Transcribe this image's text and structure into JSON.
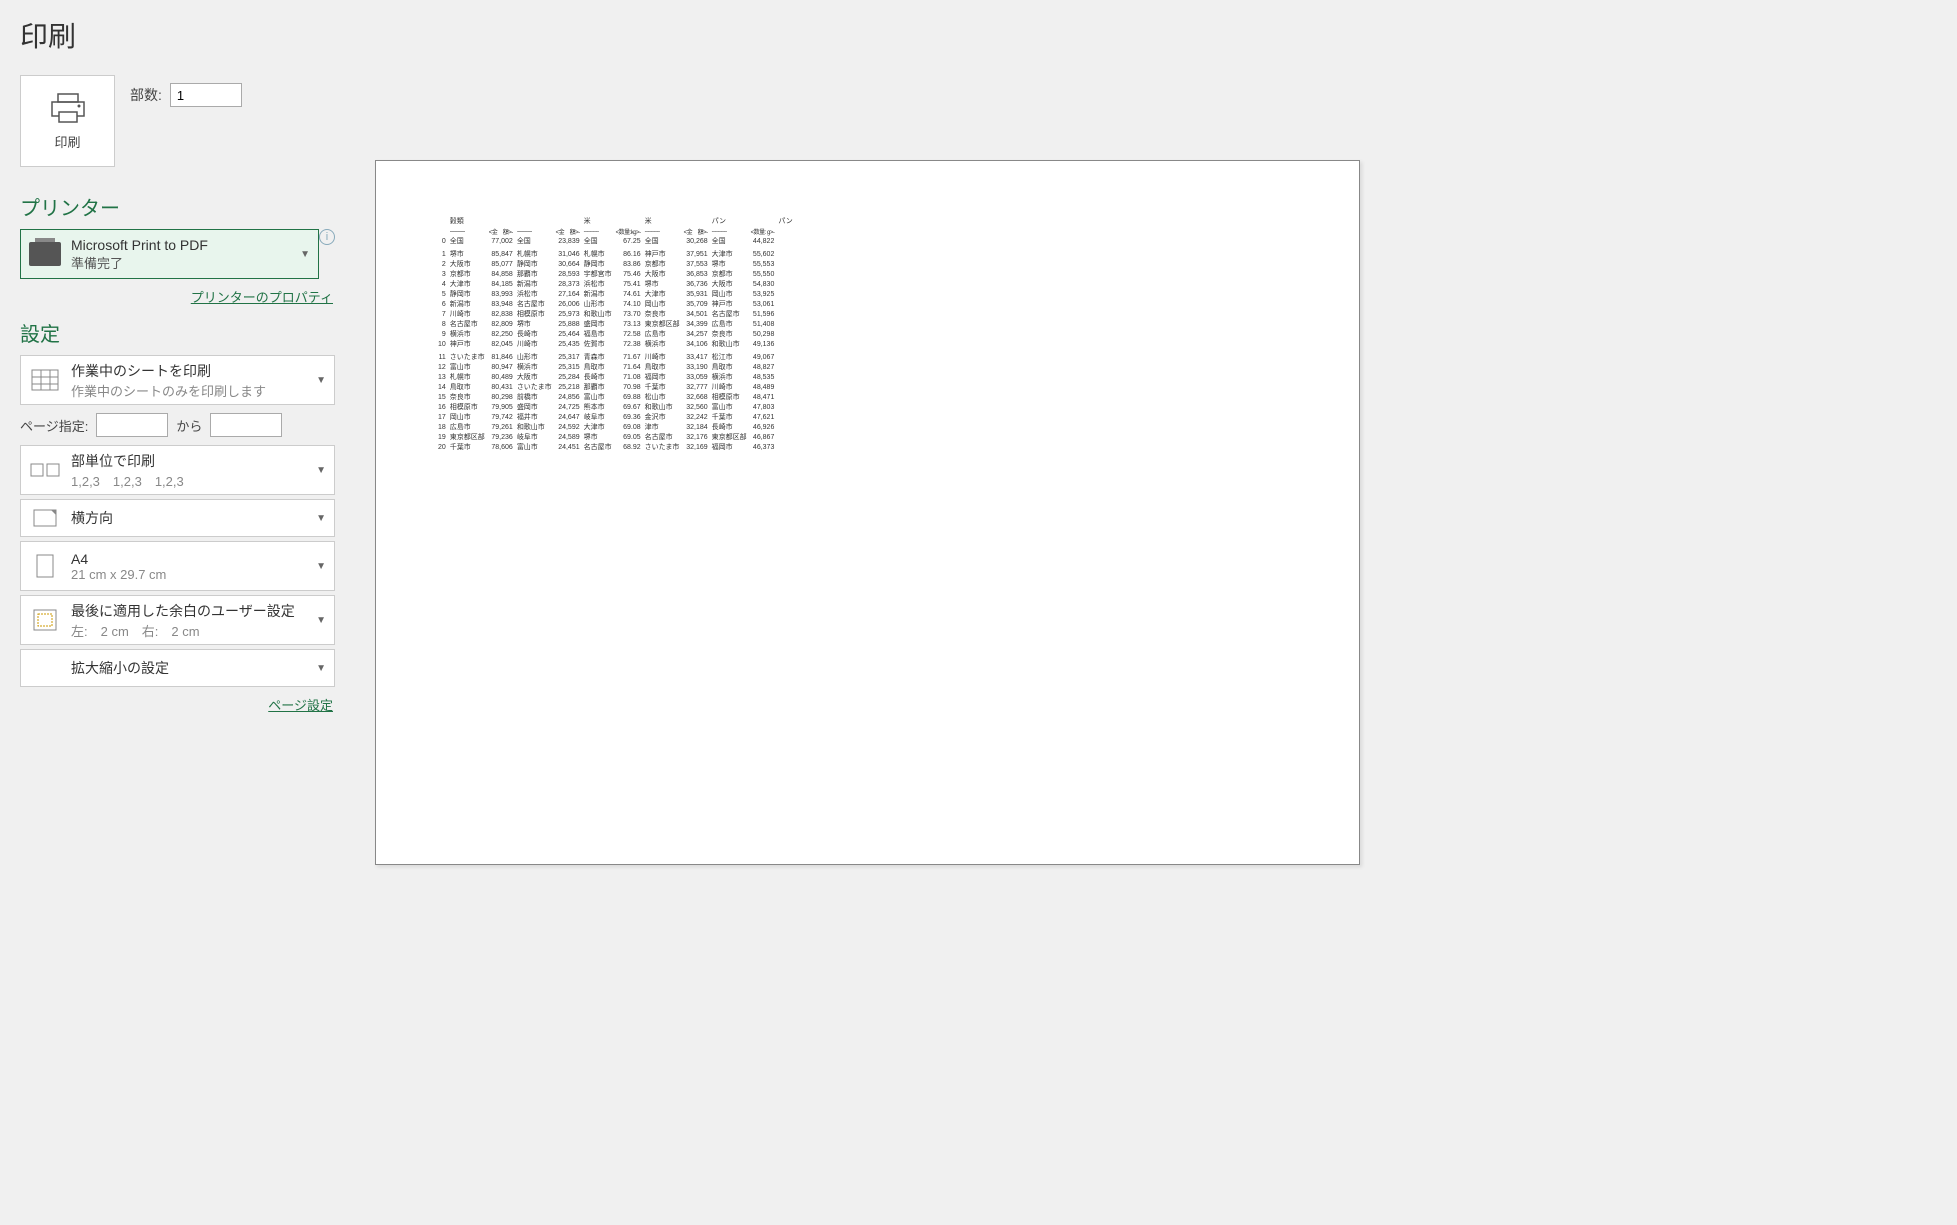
{
  "title": "印刷",
  "print_button": "印刷",
  "copies": {
    "label": "部数:",
    "value": "1"
  },
  "printer_section": {
    "heading": "プリンター",
    "selected": {
      "name": "Microsoft Print to PDF",
      "status": "準備完了"
    },
    "properties_link": "プリンターのプロパティ"
  },
  "settings_section": {
    "heading": "設定",
    "print_what": {
      "main": "作業中のシートを印刷",
      "sub": "作業中のシートのみを印刷します"
    },
    "page_range": {
      "label": "ページ指定:",
      "to": "から"
    },
    "collate": {
      "main": "部単位で印刷",
      "sub": "1,2,3　1,2,3　1,2,3"
    },
    "orientation": {
      "main": "横方向"
    },
    "paper": {
      "main": "A4",
      "sub": "21 cm x 29.7 cm"
    },
    "margins": {
      "main": "最後に適用した余白のユーザー設定",
      "sub": "左:　2 cm　右:　2 cm"
    },
    "scaling": {
      "main": "拡大縮小の設定"
    },
    "page_setup_link": "ページ設定"
  },
  "preview": {
    "header": {
      "col0": "穀類",
      "groups": [
        {
          "label": "",
          "unit": "<金　額>"
        },
        {
          "label": "米",
          "unit": "<金　額>"
        },
        {
          "label": "米",
          "unit": "<数量:kg>"
        },
        {
          "label": "パン",
          "unit": "<金　額>"
        },
        {
          "label": "パン",
          "unit": "<数量: g>"
        }
      ]
    },
    "rows": [
      {
        "r": 0,
        "c1": "全国",
        "v1": "77,002",
        "c2": "全国",
        "v2": "23,839",
        "c3": "全国",
        "v3": "67.25",
        "c4": "全国",
        "v4": "30,268",
        "c5": "全国",
        "v5": "44,822"
      },
      {
        "r": 1,
        "c1": "堺市",
        "v1": "85,847",
        "c2": "札幌市",
        "v2": "31,046",
        "c3": "札幌市",
        "v3": "86.16",
        "c4": "神戸市",
        "v4": "37,951",
        "c5": "大津市",
        "v5": "55,602"
      },
      {
        "r": 2,
        "c1": "大阪市",
        "v1": "85,077",
        "c2": "静岡市",
        "v2": "30,664",
        "c3": "静岡市",
        "v3": "83.86",
        "c4": "京都市",
        "v4": "37,553",
        "c5": "堺市",
        "v5": "55,553"
      },
      {
        "r": 3,
        "c1": "京都市",
        "v1": "84,858",
        "c2": "那覇市",
        "v2": "28,593",
        "c3": "宇都宮市",
        "v3": "75.46",
        "c4": "大阪市",
        "v4": "36,853",
        "c5": "京都市",
        "v5": "55,550"
      },
      {
        "r": 4,
        "c1": "大津市",
        "v1": "84,185",
        "c2": "新潟市",
        "v2": "28,373",
        "c3": "浜松市",
        "v3": "75.41",
        "c4": "堺市",
        "v4": "36,736",
        "c5": "大阪市",
        "v5": "54,830"
      },
      {
        "r": 5,
        "c1": "静岡市",
        "v1": "83,993",
        "c2": "浜松市",
        "v2": "27,164",
        "c3": "新潟市",
        "v3": "74.61",
        "c4": "大津市",
        "v4": "35,931",
        "c5": "岡山市",
        "v5": "53,925"
      },
      {
        "r": 6,
        "c1": "新潟市",
        "v1": "83,948",
        "c2": "名古屋市",
        "v2": "26,006",
        "c3": "山形市",
        "v3": "74.10",
        "c4": "岡山市",
        "v4": "35,709",
        "c5": "神戸市",
        "v5": "53,061"
      },
      {
        "r": 7,
        "c1": "川崎市",
        "v1": "82,838",
        "c2": "相模原市",
        "v2": "25,973",
        "c3": "和歌山市",
        "v3": "73.70",
        "c4": "奈良市",
        "v4": "34,501",
        "c5": "名古屋市",
        "v5": "51,596"
      },
      {
        "r": 8,
        "c1": "名古屋市",
        "v1": "82,809",
        "c2": "堺市",
        "v2": "25,888",
        "c3": "盛岡市",
        "v3": "73.13",
        "c4": "東京都区部",
        "v4": "34,399",
        "c5": "広島市",
        "v5": "51,408"
      },
      {
        "r": 9,
        "c1": "横浜市",
        "v1": "82,250",
        "c2": "長崎市",
        "v2": "25,464",
        "c3": "福島市",
        "v3": "72.58",
        "c4": "広島市",
        "v4": "34,257",
        "c5": "奈良市",
        "v5": "50,298"
      },
      {
        "r": 10,
        "c1": "神戸市",
        "v1": "82,045",
        "c2": "川崎市",
        "v2": "25,435",
        "c3": "佐賀市",
        "v3": "72.38",
        "c4": "横浜市",
        "v4": "34,106",
        "c5": "和歌山市",
        "v5": "49,136"
      },
      {
        "r": 11,
        "c1": "さいたま市",
        "v1": "81,846",
        "c2": "山形市",
        "v2": "25,317",
        "c3": "青森市",
        "v3": "71.67",
        "c4": "川崎市",
        "v4": "33,417",
        "c5": "松江市",
        "v5": "49,067"
      },
      {
        "r": 12,
        "c1": "富山市",
        "v1": "80,947",
        "c2": "横浜市",
        "v2": "25,315",
        "c3": "鳥取市",
        "v3": "71.64",
        "c4": "鳥取市",
        "v4": "33,190",
        "c5": "鳥取市",
        "v5": "48,827"
      },
      {
        "r": 13,
        "c1": "札幌市",
        "v1": "80,489",
        "c2": "大阪市",
        "v2": "25,284",
        "c3": "長崎市",
        "v3": "71.08",
        "c4": "福岡市",
        "v4": "33,059",
        "c5": "横浜市",
        "v5": "48,535"
      },
      {
        "r": 14,
        "c1": "鳥取市",
        "v1": "80,431",
        "c2": "さいたま市",
        "v2": "25,218",
        "c3": "那覇市",
        "v3": "70.98",
        "c4": "千葉市",
        "v4": "32,777",
        "c5": "川崎市",
        "v5": "48,489"
      },
      {
        "r": 15,
        "c1": "奈良市",
        "v1": "80,298",
        "c2": "前橋市",
        "v2": "24,856",
        "c3": "富山市",
        "v3": "69.88",
        "c4": "松山市",
        "v4": "32,668",
        "c5": "相模原市",
        "v5": "48,471"
      },
      {
        "r": 16,
        "c1": "相模原市",
        "v1": "79,905",
        "c2": "盛岡市",
        "v2": "24,725",
        "c3": "熊本市",
        "v3": "69.67",
        "c4": "和歌山市",
        "v4": "32,560",
        "c5": "富山市",
        "v5": "47,803"
      },
      {
        "r": 17,
        "c1": "岡山市",
        "v1": "79,742",
        "c2": "福井市",
        "v2": "24,647",
        "c3": "岐阜市",
        "v3": "69.36",
        "c4": "金沢市",
        "v4": "32,242",
        "c5": "千葉市",
        "v5": "47,621"
      },
      {
        "r": 18,
        "c1": "広島市",
        "v1": "79,261",
        "c2": "和歌山市",
        "v2": "24,592",
        "c3": "大津市",
        "v3": "69.08",
        "c4": "津市",
        "v4": "32,184",
        "c5": "長崎市",
        "v5": "46,926"
      },
      {
        "r": 19,
        "c1": "東京都区部",
        "v1": "79,236",
        "c2": "岐阜市",
        "v2": "24,589",
        "c3": "堺市",
        "v3": "69.05",
        "c4": "名古屋市",
        "v4": "32,176",
        "c5": "東京都区部",
        "v5": "46,867"
      },
      {
        "r": 20,
        "c1": "千葉市",
        "v1": "78,606",
        "c2": "富山市",
        "v2": "24,451",
        "c3": "名古屋市",
        "v3": "68.92",
        "c4": "さいたま市",
        "v4": "32,169",
        "c5": "福岡市",
        "v5": "46,373"
      }
    ]
  }
}
